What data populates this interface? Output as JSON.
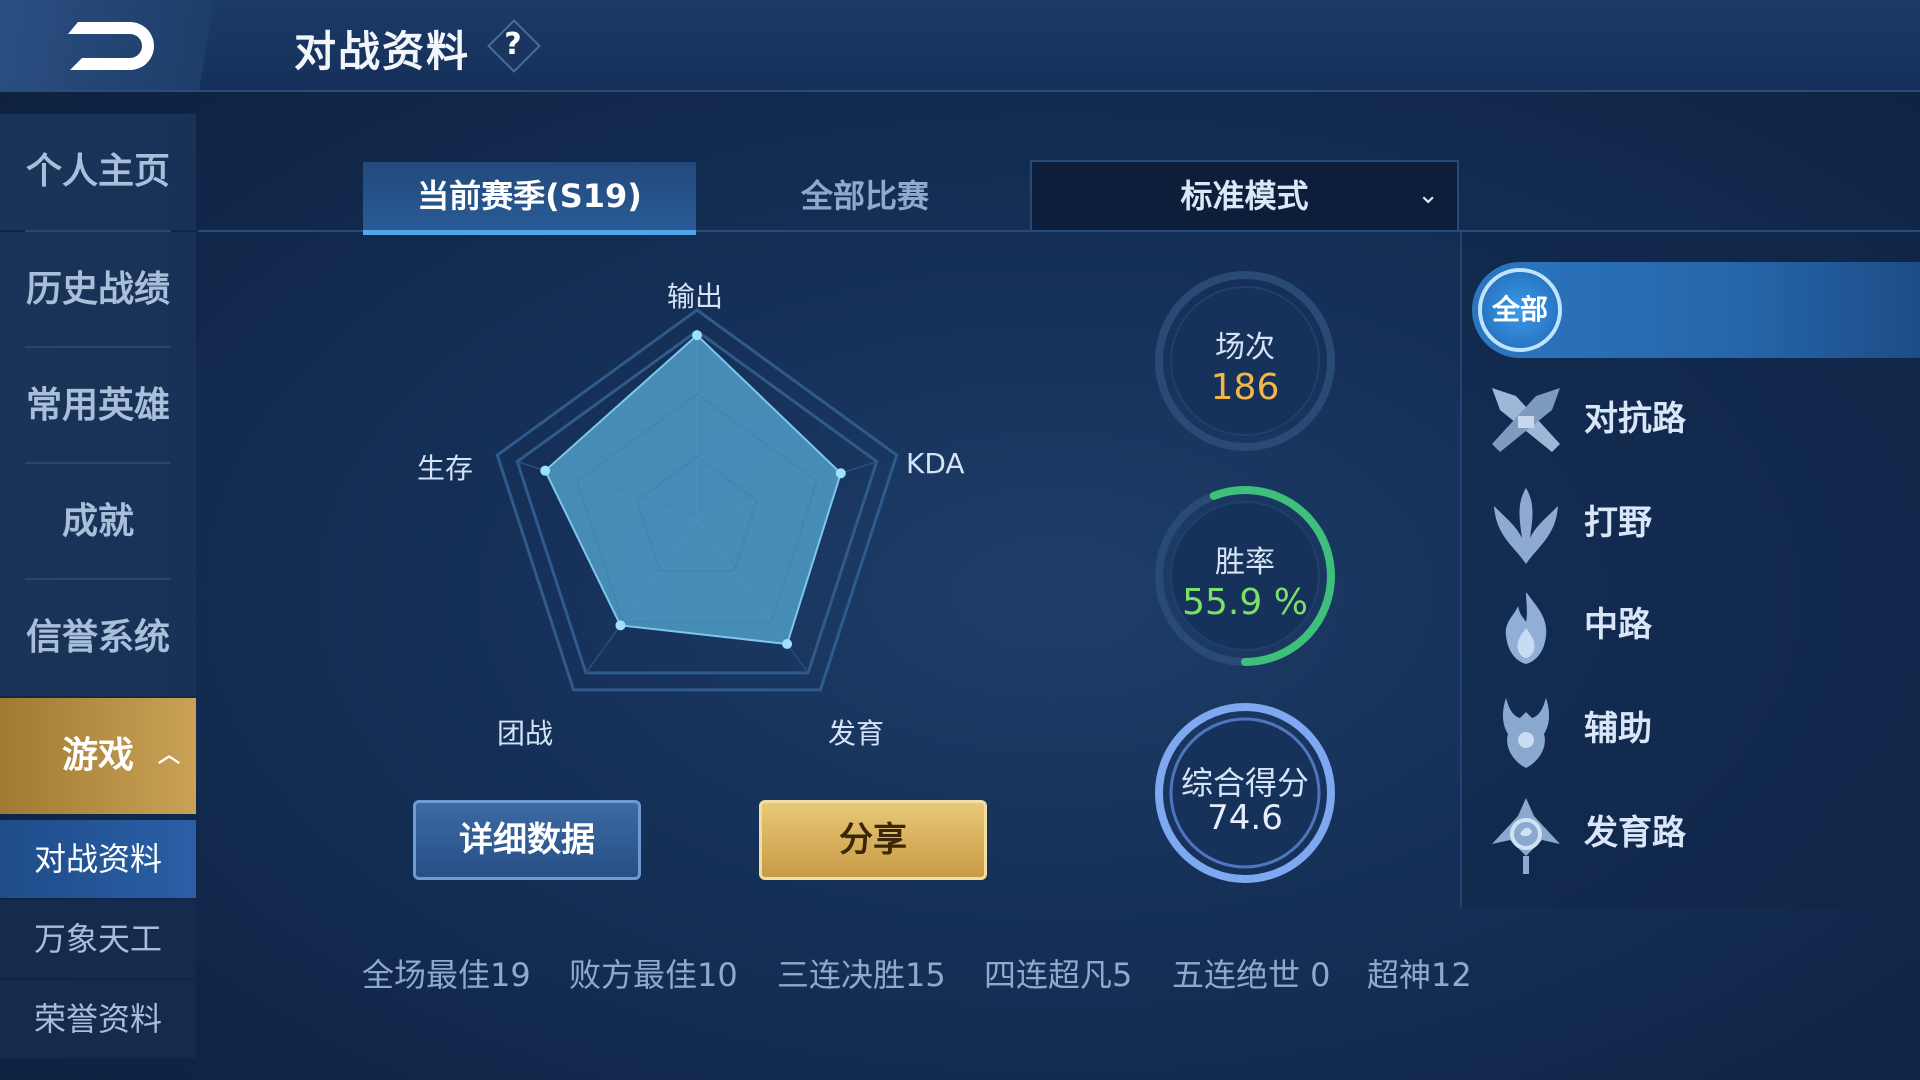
{
  "header": {
    "title": "对战资料",
    "help": "?"
  },
  "sidebar": {
    "items": [
      {
        "label": "个人主页"
      },
      {
        "label": "历史战绩"
      },
      {
        "label": "常用英雄"
      },
      {
        "label": "成就"
      },
      {
        "label": "信誉系统"
      },
      {
        "label": "游戏"
      }
    ],
    "subitems": [
      {
        "label": "对战资料"
      },
      {
        "label": "万象天工"
      },
      {
        "label": "荣誉资料"
      }
    ]
  },
  "tabs": [
    {
      "label": "当前赛季(S19)"
    },
    {
      "label": "全部比赛"
    }
  ],
  "mode_select": {
    "value": "标准模式"
  },
  "radar": {
    "axes": [
      "输出",
      "KDA",
      "发育",
      "团战",
      "生存"
    ],
    "values": [
      0.88,
      0.72,
      0.73,
      0.62,
      0.76
    ],
    "fill_color": "#4f9cc6"
  },
  "buttons": {
    "detail": "详细数据",
    "share": "分享"
  },
  "summary": {
    "matches_label": "场次",
    "matches_value": "186",
    "winrate_label": "胜率",
    "winrate_value": "55.9 %",
    "winrate_fraction": 0.559,
    "score_label": "综合得分",
    "score_value": "74.6",
    "colors": {
      "matches": "#f3b64a",
      "winrate": "#7be06a",
      "ring_win": "#3ec07a",
      "ring_score": "#7ea8f0"
    }
  },
  "roles": [
    {
      "label": "全部",
      "icon": "all-badge"
    },
    {
      "label": "对抗路",
      "icon": "crossed-swords-icon"
    },
    {
      "label": "打野",
      "icon": "leaf-claw-icon"
    },
    {
      "label": "中路",
      "icon": "flame-icon"
    },
    {
      "label": "辅助",
      "icon": "horned-shield-icon"
    },
    {
      "label": "发育路",
      "icon": "bow-emblem-icon"
    }
  ],
  "stats": [
    {
      "label": "全场最佳19"
    },
    {
      "label": "败方最佳10"
    },
    {
      "label": "三连决胜15"
    },
    {
      "label": "四连超凡5"
    },
    {
      "label": "五连绝世 0"
    },
    {
      "label": "超神12"
    }
  ]
}
